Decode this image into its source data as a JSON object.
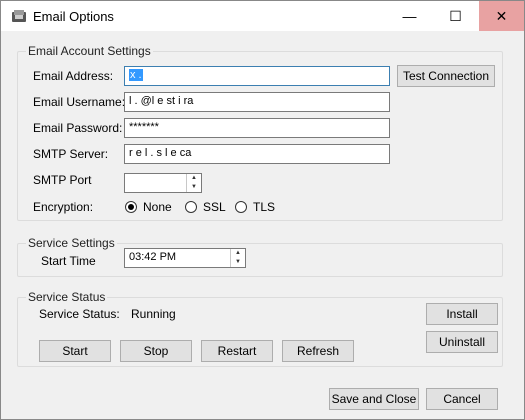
{
  "window": {
    "title": "Email Options",
    "minimize": "—",
    "maximize": "☐",
    "close": "✕"
  },
  "email_account": {
    "title": "Email Account Settings",
    "address_label": "Email Address:",
    "address_value": "x           .",
    "username_label": "Email Username:",
    "username_value": "l  . @l  e    st   i    ra",
    "password_label": "Email Password:",
    "password_value": "*******",
    "smtp_server_label": "SMTP Server:",
    "smtp_server_value": "r  e l  . s  l e  ca",
    "smtp_port_label": "SMTP Port",
    "smtp_port_value": "",
    "encryption_label": "Encryption:",
    "encryption_options": [
      "None",
      "SSL",
      "TLS"
    ],
    "encryption_selected": "None",
    "test_connection_label": "Test Connection"
  },
  "service_settings": {
    "title": "Service Settings",
    "start_time_label": "Start Time",
    "start_time_value": "03:42 PM"
  },
  "service_status": {
    "title": "Service Status",
    "status_label": "Service Status:",
    "status_value": "Running",
    "install_label": "Install",
    "uninstall_label": "Uninstall",
    "start_label": "Start",
    "stop_label": "Stop",
    "restart_label": "Restart",
    "refresh_label": "Refresh"
  },
  "footer": {
    "save_close_label": "Save and Close",
    "cancel_label": "Cancel"
  }
}
